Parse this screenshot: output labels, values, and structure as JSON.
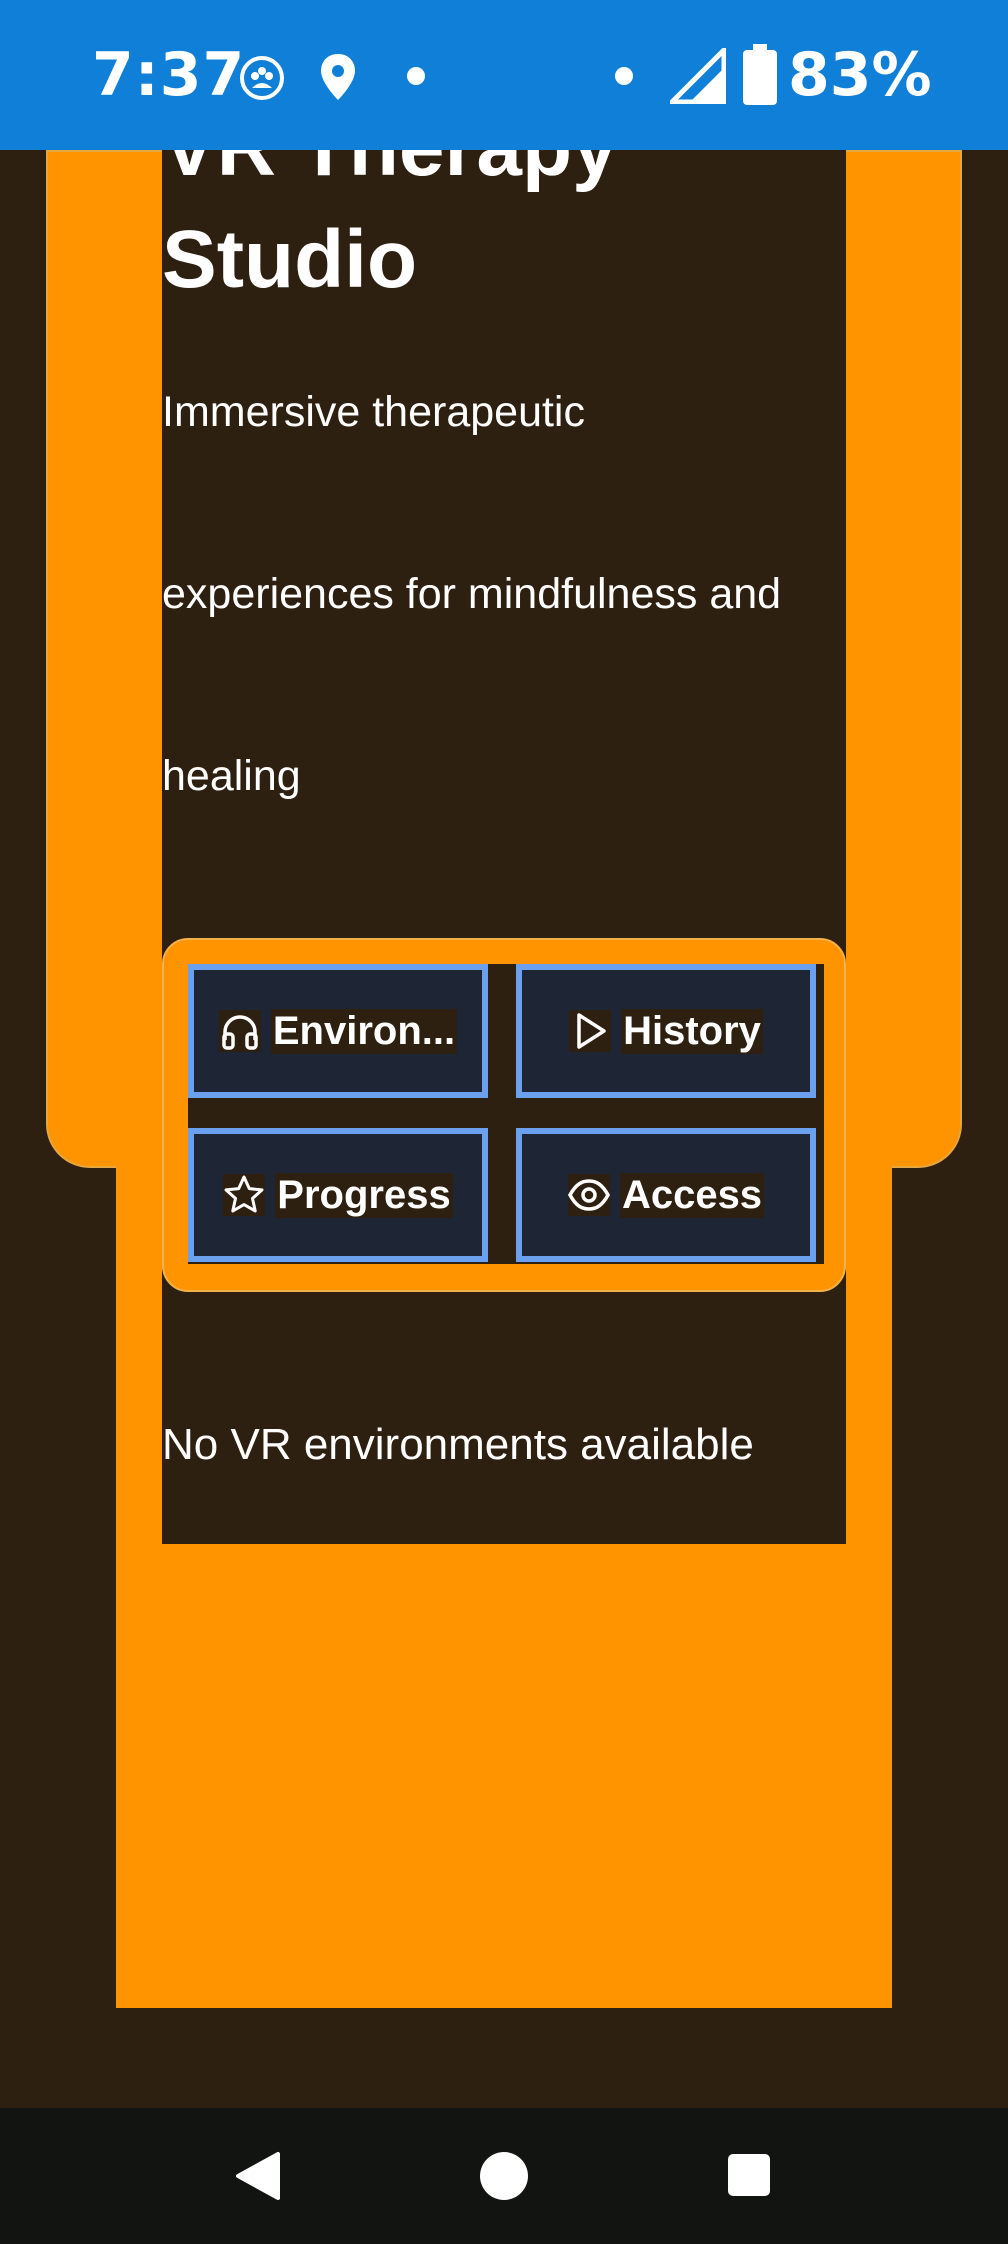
{
  "status_bar": {
    "time": "7:37",
    "battery_percent": "83%",
    "icons": [
      "app-notification-icon",
      "location-icon",
      "dot-icon",
      "dot-icon",
      "signal-icon",
      "battery-icon"
    ]
  },
  "header": {
    "title_line1": "VR Therapy",
    "title_line2": "Studio"
  },
  "description": {
    "line1": "Immersive therapeutic",
    "line2": "experiences for mindfulness and",
    "line3": "healing"
  },
  "actions": [
    {
      "label": "Environ...",
      "icon": "headphones-icon"
    },
    {
      "label": "History",
      "icon": "play-icon"
    },
    {
      "label": "Progress",
      "icon": "star-icon"
    },
    {
      "label": "Access",
      "icon": "eye-icon"
    }
  ],
  "empty_state": "No VR environments available",
  "colors": {
    "status_bar": "#0f7fd8",
    "accent": "#ff9400",
    "background": "#2e2010",
    "button_bg": "#1e2535",
    "button_border": "#6aa0ee"
  },
  "nav_bar": {
    "buttons": [
      "back-icon",
      "home-icon",
      "recents-icon"
    ]
  }
}
